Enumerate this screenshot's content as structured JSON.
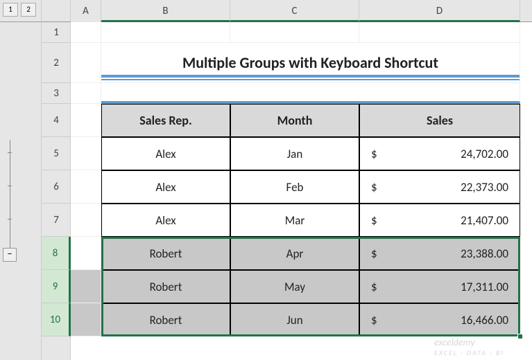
{
  "outline": {
    "level1": "1",
    "level2": "2",
    "collapse": "−"
  },
  "columns": {
    "A": "A",
    "B": "B",
    "C": "C",
    "D": "D"
  },
  "rows": {
    "r1": "1",
    "r2": "2",
    "r3": "3",
    "r4": "4",
    "r5": "5",
    "r6": "6",
    "r7": "7",
    "r8": "8",
    "r9": "9",
    "r10": "10"
  },
  "title": "Multiple Groups with Keyboard Shortcut",
  "headers": {
    "rep": "Sales Rep.",
    "month": "Month",
    "sales": "Sales"
  },
  "chart_data": {
    "type": "table",
    "columns": [
      "Sales Rep.",
      "Month",
      "Sales"
    ],
    "rows": [
      {
        "rep": "Alex",
        "month": "Jan",
        "currency": "$",
        "sales": "24,702.00",
        "value": 24702.0
      },
      {
        "rep": "Alex",
        "month": "Feb",
        "currency": "$",
        "sales": "22,373.00",
        "value": 22373.0
      },
      {
        "rep": "Alex",
        "month": "Mar",
        "currency": "$",
        "sales": "21,407.00",
        "value": 21407.0
      },
      {
        "rep": "Robert",
        "month": "Apr",
        "currency": "$",
        "sales": "23,388.00",
        "value": 23388.0
      },
      {
        "rep": "Robert",
        "month": "May",
        "currency": "$",
        "sales": "17,311.00",
        "value": 17311.0
      },
      {
        "rep": "Robert",
        "month": "Jun",
        "currency": "$",
        "sales": "16,466.00",
        "value": 16466.0
      }
    ]
  },
  "watermark": {
    "main": "exceldemy",
    "sub": "EXCEL · DATA · BI"
  }
}
